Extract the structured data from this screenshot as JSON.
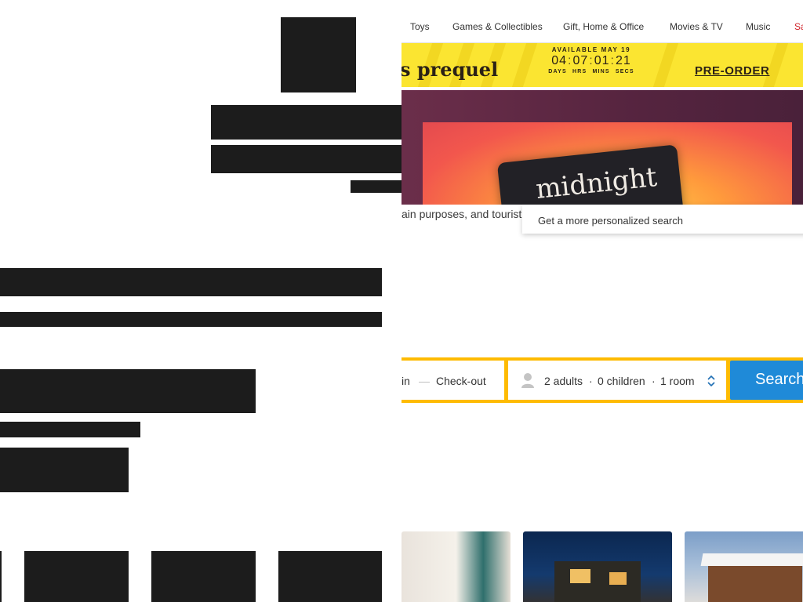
{
  "nav": {
    "items": [
      "Toys",
      "Games & Collectibles",
      "Gift, Home & Office",
      "Movies & TV",
      "Music",
      "Sa"
    ]
  },
  "promo": {
    "title": "s prequel",
    "available": "AVAILABLE MAY 19",
    "countdown": {
      "days": "04",
      "hrs": "07",
      "mins": "01",
      "secs": "21"
    },
    "units": "DAYS HRS MINS SECS",
    "preorder_label": "PRE-ORDER"
  },
  "book": {
    "title": "midnight"
  },
  "search": {
    "tagline": "ain purposes, and tourist",
    "suggestion": "Get a more personalized search",
    "checkin_label": "in",
    "dash": "—",
    "checkout_label": "Check-out",
    "adults": "2 adults",
    "children": "0 children",
    "rooms": "1 room",
    "dot": "·",
    "button_label": "Search"
  },
  "colors": {
    "promo_yellow": "#fbe531",
    "search_yellow": "#febb02",
    "search_blue": "#1f8ad8",
    "sale_red": "#d0242b",
    "redaction": "#1c1c1c"
  },
  "icons": [
    "person-icon",
    "sort-arrows-icon"
  ]
}
